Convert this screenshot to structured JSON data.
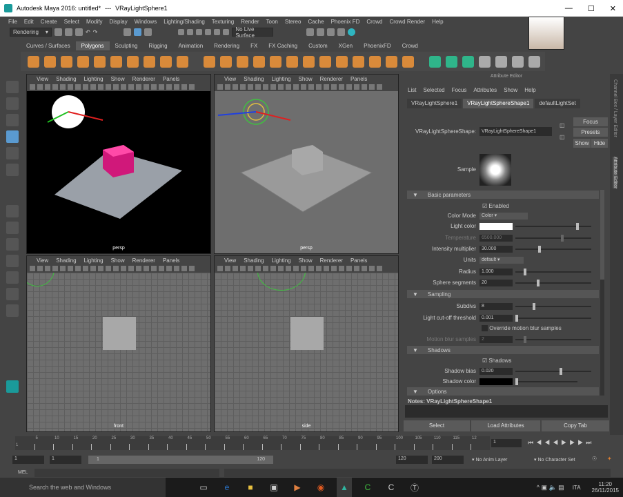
{
  "title": {
    "app": "Autodesk Maya 2016: untitled*",
    "sep": "---",
    "object": "VRayLightSphere1"
  },
  "menu": [
    "File",
    "Edit",
    "Create",
    "Select",
    "Modify",
    "Display",
    "Windows",
    "Lighting/Shading",
    "Texturing",
    "Render",
    "Toon",
    "Stereo",
    "Cache",
    "Phoenix FD",
    "Crowd",
    "Crowd Render",
    "Help"
  ],
  "status": {
    "menuset": "Rendering",
    "live_surface": "No Live Surface"
  },
  "shelf_tabs": [
    "Curves / Surfaces",
    "Polygons",
    "Sculpting",
    "Rigging",
    "Animation",
    "Rendering",
    "FX",
    "FX Caching",
    "Custom",
    "XGen",
    "PhoenixFD",
    "Crowd"
  ],
  "viewport_menu": [
    "View",
    "Shading",
    "Lighting",
    "Show",
    "Renderer",
    "Panels"
  ],
  "viewports": [
    "persp",
    "persp",
    "front",
    "side"
  ],
  "ae": {
    "title": "Attribute Editor",
    "menu": [
      "List",
      "Selected",
      "Focus",
      "Attributes",
      "Show",
      "Help"
    ],
    "tabs": [
      "VRayLightSphere1",
      "VRayLightSphereShape1",
      "defaultLightSet"
    ],
    "shape_label": "VRayLightSphereShape:",
    "shape_value": "VRayLightSphereShape1",
    "focus": "Focus",
    "presets": "Presets",
    "show": "Show",
    "hide": "Hide",
    "sample": "Sample",
    "sections": [
      "Basic parameters",
      "Sampling",
      "Shadows",
      "Options"
    ],
    "enabled": "Enabled",
    "color_mode_label": "Color Mode",
    "color_mode": "Color",
    "light_color": "Light color",
    "temperature_label": "Temperature",
    "temperature": "6500.000",
    "intensity_label": "Intensity multiplier",
    "intensity": "30.000",
    "units_label": "Units",
    "units": "default",
    "radius_label": "Radius",
    "radius": "1.000",
    "segments_label": "Sphere segments",
    "segments": "20",
    "subdivs_label": "Subdivs",
    "subdivs": "8",
    "cutoff_label": "Light cut-off threshold",
    "cutoff": "0.001",
    "override_label": "Override motion blur samples",
    "mb_label": "Motion blur samples",
    "mb": "2",
    "shadows_label": "Shadows",
    "bias_label": "Shadow bias",
    "bias": "0.020",
    "shadow_color_label": "Shadow color",
    "notes": "Notes:  VRayLightSphereShape1",
    "select": "Select",
    "load": "Load Attributes",
    "copy": "Copy Tab"
  },
  "side_tabs": [
    "Channel Box / Layer Editor",
    "Attribute Editor"
  ],
  "timeline": {
    "ticks": [
      "5",
      "10",
      "15",
      "20",
      "25",
      "30",
      "35",
      "40",
      "45",
      "50",
      "55",
      "60",
      "65",
      "70",
      "75",
      "80",
      "85",
      "90",
      "95",
      "100",
      "105",
      "110",
      "115",
      "12"
    ],
    "start": "1",
    "current": "1"
  },
  "range": {
    "start": "1",
    "playstart": "1",
    "slider_start": "1",
    "slider_end": "120",
    "playend": "120",
    "end": "200",
    "anim_layer": "No Anim Layer",
    "char_set": "No Character Set"
  },
  "cmd": {
    "label": "MEL"
  },
  "taskbar": {
    "search": "Search the web and Windows",
    "lang": "ITA",
    "time": "11:20",
    "date": "26/11/2015"
  }
}
